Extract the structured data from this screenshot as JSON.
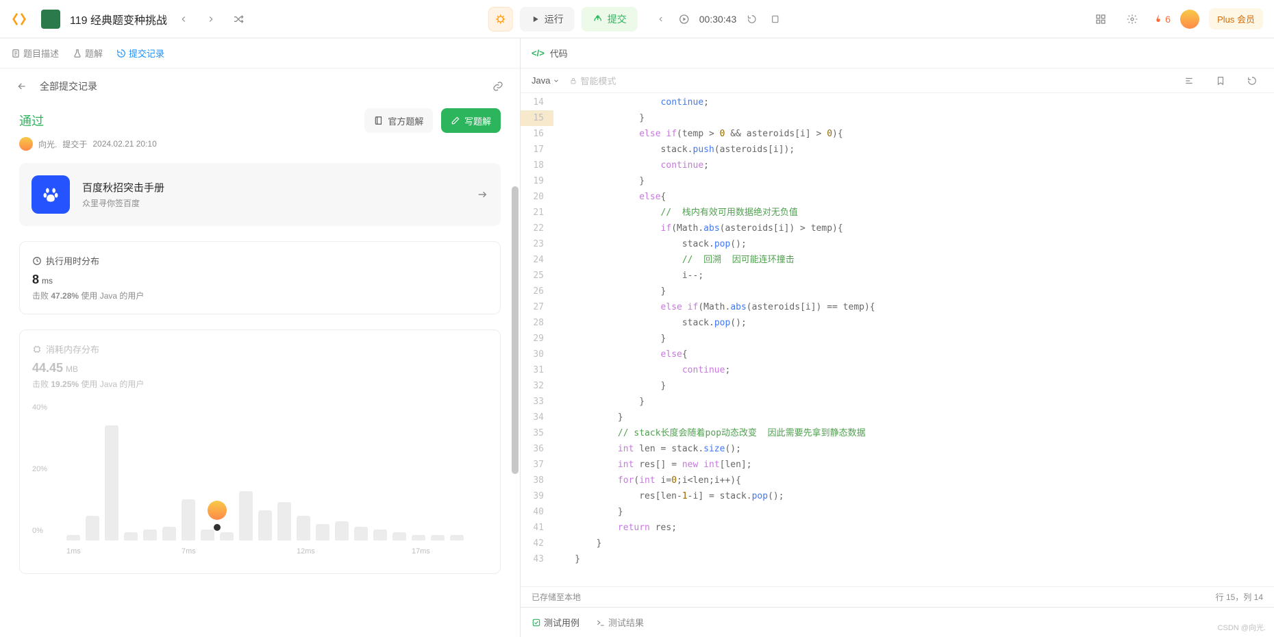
{
  "top": {
    "title": "119 经典题变种挑战",
    "run": "运行",
    "submit": "提交",
    "timer": "00:30:43",
    "fire_count": "6",
    "plus": "Plus 会员"
  },
  "tabs": {
    "desc": "题目描述",
    "solution": "题解",
    "submissions": "提交记录"
  },
  "subheader": {
    "back": "全部提交记录"
  },
  "submission": {
    "status": "通过",
    "user": "向光.",
    "meta_prefix": "提交于",
    "timestamp": "2024.02.21 20:10",
    "official": "官方题解",
    "write": "写题解"
  },
  "promo": {
    "title": "百度秋招突击手册",
    "sub": "众里寻你签百度"
  },
  "runtime": {
    "title": "执行用时分布",
    "value": "8",
    "unit": "ms",
    "desc_prefix": "击败",
    "percent": "47.28%",
    "desc_suffix": "使用 Java 的用户"
  },
  "memory": {
    "title": "消耗内存分布",
    "value": "44.45",
    "unit": "MB",
    "desc_prefix": "击败",
    "percent": "19.25%",
    "desc_suffix": "使用 Java 的用户"
  },
  "chart_data": {
    "type": "bar",
    "ylabels": [
      "40%",
      "20%",
      "0%"
    ],
    "xticks": [
      "1ms",
      "7ms",
      "12ms",
      "17ms"
    ],
    "bars_pct": [
      2,
      9,
      42,
      3,
      4,
      5,
      15,
      4,
      3,
      18,
      11,
      14,
      9,
      6,
      7,
      5,
      4,
      3,
      2,
      2,
      2
    ],
    "marker_index": 7
  },
  "code_panel": {
    "header": "代码",
    "language": "Java",
    "smart": "智能模式",
    "saved": "已存储至本地",
    "cursor": "行 15，列 14"
  },
  "code_lines": [
    {
      "n": 14,
      "seg": [
        [
          "pu",
          "                    "
        ],
        [
          "fn",
          "continue"
        ],
        [
          "pu",
          ";"
        ]
      ]
    },
    {
      "n": 15,
      "hl": true,
      "seg": [
        [
          "pu",
          "                }"
        ]
      ]
    },
    {
      "n": 16,
      "seg": [
        [
          "pu",
          "                "
        ],
        [
          "kw",
          "else if"
        ],
        [
          "pu",
          "(temp > "
        ],
        [
          "num",
          "0"
        ],
        [
          "pu",
          " && asteroids[i] > "
        ],
        [
          "num",
          "0"
        ],
        [
          "pu",
          "){"
        ]
      ]
    },
    {
      "n": 17,
      "seg": [
        [
          "pu",
          "                    stack."
        ],
        [
          "fn",
          "push"
        ],
        [
          "pu",
          "(asteroids[i]);"
        ]
      ]
    },
    {
      "n": 18,
      "seg": [
        [
          "pu",
          "                    "
        ],
        [
          "kw",
          "continue"
        ],
        [
          "pu",
          ";"
        ]
      ]
    },
    {
      "n": 19,
      "seg": [
        [
          "pu",
          "                }"
        ]
      ]
    },
    {
      "n": 20,
      "seg": [
        [
          "pu",
          "                "
        ],
        [
          "kw",
          "else"
        ],
        [
          "pu",
          "{"
        ]
      ]
    },
    {
      "n": 21,
      "seg": [
        [
          "pu",
          "                    "
        ],
        [
          "cm",
          "//  栈内有效可用数据绝对无负值"
        ]
      ]
    },
    {
      "n": 22,
      "seg": [
        [
          "pu",
          "                    "
        ],
        [
          "kw",
          "if"
        ],
        [
          "pu",
          "(Math."
        ],
        [
          "fn",
          "abs"
        ],
        [
          "pu",
          "(asteroids[i]) > temp){"
        ]
      ]
    },
    {
      "n": 23,
      "seg": [
        [
          "pu",
          "                        stack."
        ],
        [
          "fn",
          "pop"
        ],
        [
          "pu",
          "();"
        ]
      ]
    },
    {
      "n": 24,
      "seg": [
        [
          "pu",
          "                        "
        ],
        [
          "cm",
          "//  回溯  因可能连环撞击"
        ]
      ]
    },
    {
      "n": 25,
      "seg": [
        [
          "pu",
          "                        i--;"
        ]
      ]
    },
    {
      "n": 26,
      "seg": [
        [
          "pu",
          "                    }"
        ]
      ]
    },
    {
      "n": 27,
      "seg": [
        [
          "pu",
          "                    "
        ],
        [
          "kw",
          "else if"
        ],
        [
          "pu",
          "(Math."
        ],
        [
          "fn",
          "abs"
        ],
        [
          "pu",
          "(asteroids[i]) == temp){"
        ]
      ]
    },
    {
      "n": 28,
      "seg": [
        [
          "pu",
          "                        stack."
        ],
        [
          "fn",
          "pop"
        ],
        [
          "pu",
          "();"
        ]
      ]
    },
    {
      "n": 29,
      "seg": [
        [
          "pu",
          "                    }"
        ]
      ]
    },
    {
      "n": 30,
      "seg": [
        [
          "pu",
          "                    "
        ],
        [
          "kw",
          "else"
        ],
        [
          "pu",
          "{"
        ]
      ]
    },
    {
      "n": 31,
      "seg": [
        [
          "pu",
          "                        "
        ],
        [
          "kw",
          "continue"
        ],
        [
          "pu",
          ";"
        ]
      ]
    },
    {
      "n": 32,
      "seg": [
        [
          "pu",
          "                    }"
        ]
      ]
    },
    {
      "n": 33,
      "seg": [
        [
          "pu",
          "                }"
        ]
      ]
    },
    {
      "n": 34,
      "seg": [
        [
          "pu",
          "            }"
        ]
      ]
    },
    {
      "n": 35,
      "seg": [
        [
          "pu",
          "            "
        ],
        [
          "cm",
          "// stack长度会随着pop动态改变  因此需要先拿到静态数据"
        ]
      ]
    },
    {
      "n": 36,
      "seg": [
        [
          "pu",
          "            "
        ],
        [
          "ty",
          "int"
        ],
        [
          "pu",
          " len = stack."
        ],
        [
          "fn",
          "size"
        ],
        [
          "pu",
          "();"
        ]
      ]
    },
    {
      "n": 37,
      "seg": [
        [
          "pu",
          "            "
        ],
        [
          "ty",
          "int"
        ],
        [
          "pu",
          " res[] = "
        ],
        [
          "kw",
          "new"
        ],
        [
          "pu",
          " "
        ],
        [
          "ty",
          "int"
        ],
        [
          "pu",
          "[len];"
        ]
      ]
    },
    {
      "n": 38,
      "seg": [
        [
          "pu",
          "            "
        ],
        [
          "kw",
          "for"
        ],
        [
          "pu",
          "("
        ],
        [
          "ty",
          "int"
        ],
        [
          "pu",
          " i="
        ],
        [
          "num",
          "0"
        ],
        [
          "pu",
          ";i<len;i++){"
        ]
      ]
    },
    {
      "n": 39,
      "seg": [
        [
          "pu",
          "                res[len-"
        ],
        [
          "num",
          "1"
        ],
        [
          "pu",
          "-i] = stack."
        ],
        [
          "fn",
          "pop"
        ],
        [
          "pu",
          "();"
        ]
      ]
    },
    {
      "n": 40,
      "seg": [
        [
          "pu",
          "            }"
        ]
      ]
    },
    {
      "n": 41,
      "seg": [
        [
          "pu",
          "            "
        ],
        [
          "kw",
          "return"
        ],
        [
          "pu",
          " res;"
        ]
      ]
    },
    {
      "n": 42,
      "seg": [
        [
          "pu",
          "        }"
        ]
      ]
    },
    {
      "n": 43,
      "seg": [
        [
          "pu",
          "    }"
        ]
      ]
    }
  ],
  "test": {
    "cases": "测试用例",
    "results": "测试结果"
  },
  "watermark": "CSDN @向光."
}
